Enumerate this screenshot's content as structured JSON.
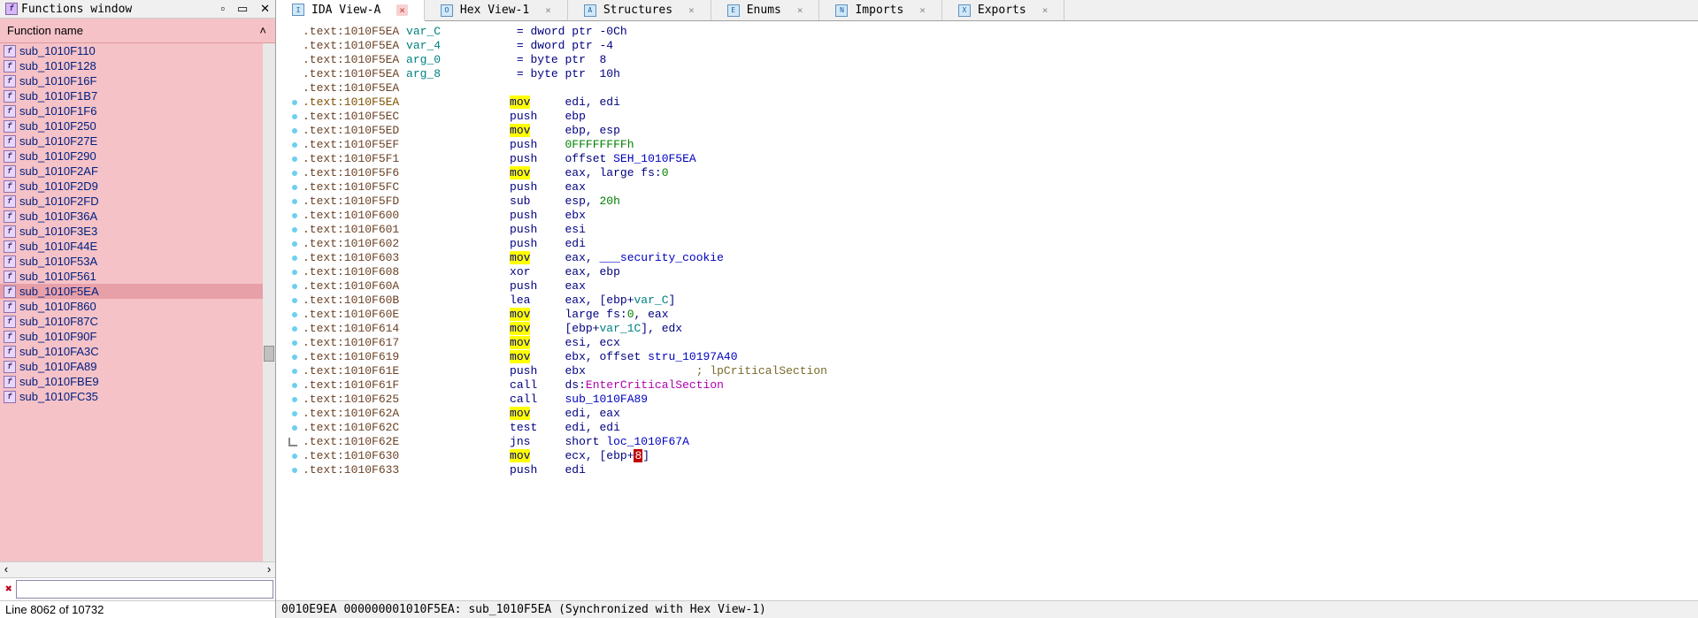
{
  "left": {
    "title": "Functions window",
    "column": "Function name",
    "functions": [
      {
        "name": "sub_1010F110",
        "selected": false
      },
      {
        "name": "sub_1010F128",
        "selected": false
      },
      {
        "name": "sub_1010F16F",
        "selected": false
      },
      {
        "name": "sub_1010F1B7",
        "selected": false
      },
      {
        "name": "sub_1010F1F6",
        "selected": false
      },
      {
        "name": "sub_1010F250",
        "selected": false
      },
      {
        "name": "sub_1010F27E",
        "selected": false
      },
      {
        "name": "sub_1010F290",
        "selected": false
      },
      {
        "name": "sub_1010F2AF",
        "selected": false
      },
      {
        "name": "sub_1010F2D9",
        "selected": false
      },
      {
        "name": "sub_1010F2FD",
        "selected": false
      },
      {
        "name": "sub_1010F36A",
        "selected": false
      },
      {
        "name": "sub_1010F3E3",
        "selected": false
      },
      {
        "name": "sub_1010F44E",
        "selected": false
      },
      {
        "name": "sub_1010F53A",
        "selected": false
      },
      {
        "name": "sub_1010F561",
        "selected": false
      },
      {
        "name": "sub_1010F5EA",
        "selected": true
      },
      {
        "name": "sub_1010F860",
        "selected": false
      },
      {
        "name": "sub_1010F87C",
        "selected": false
      },
      {
        "name": "sub_1010F90F",
        "selected": false
      },
      {
        "name": "sub_1010FA3C",
        "selected": false
      },
      {
        "name": "sub_1010FA89",
        "selected": false
      },
      {
        "name": "sub_1010FBE9",
        "selected": false
      },
      {
        "name": "sub_1010FC35",
        "selected": false
      }
    ],
    "status": "Line 8062 of 10732"
  },
  "tabs": [
    {
      "label": "IDA View-A",
      "active": true,
      "icon": "I"
    },
    {
      "label": "Hex View-1",
      "active": false,
      "icon": "O"
    },
    {
      "label": "Structures",
      "active": false,
      "icon": "A"
    },
    {
      "label": "Enums",
      "active": false,
      "icon": "E"
    },
    {
      "label": "Imports",
      "active": false,
      "icon": "N"
    },
    {
      "label": "Exports",
      "active": false,
      "icon": "X"
    }
  ],
  "disasm": [
    {
      "dot": false,
      "addr": ".text:1010F5EA",
      "var": "var_C",
      "eq": "= dword ptr -0Ch"
    },
    {
      "dot": false,
      "addr": ".text:1010F5EA",
      "var": "var_4",
      "eq": "= dword ptr -4"
    },
    {
      "dot": false,
      "addr": ".text:1010F5EA",
      "var": "arg_0",
      "eq": "= byte ptr  8"
    },
    {
      "dot": false,
      "addr": ".text:1010F5EA",
      "var": "arg_8",
      "eq": "= byte ptr  10h"
    },
    {
      "dot": false,
      "addr": ".text:1010F5EA"
    },
    {
      "dot": true,
      "addr": ".text:1010F5EA",
      "addrcls": "addr-b",
      "mn": "mov",
      "hl": true,
      "ops": [
        {
          "t": "edi, edi",
          "c": "op-reg"
        }
      ]
    },
    {
      "dot": true,
      "addr": ".text:1010F5EC",
      "mn": "push",
      "ops": [
        {
          "t": "ebp",
          "c": "op-reg"
        }
      ]
    },
    {
      "dot": true,
      "addr": ".text:1010F5ED",
      "mn": "mov",
      "hl": true,
      "ops": [
        {
          "t": "ebp, esp",
          "c": "op-reg"
        }
      ]
    },
    {
      "dot": true,
      "addr": ".text:1010F5EF",
      "mn": "push",
      "ops": [
        {
          "t": "0FFFFFFFFh",
          "c": "op-const"
        }
      ]
    },
    {
      "dot": true,
      "addr": ".text:1010F5F1",
      "mn": "push",
      "ops": [
        {
          "t": "offset ",
          "c": "op-reg"
        },
        {
          "t": "SEH_1010F5EA",
          "c": "op-ref"
        }
      ]
    },
    {
      "dot": true,
      "addr": ".text:1010F5F6",
      "mn": "mov",
      "hl": true,
      "ops": [
        {
          "t": "eax, ",
          "c": "op-reg"
        },
        {
          "t": "large fs:",
          "c": "op-reg"
        },
        {
          "t": "0",
          "c": "op-const"
        }
      ]
    },
    {
      "dot": true,
      "addr": ".text:1010F5FC",
      "mn": "push",
      "ops": [
        {
          "t": "eax",
          "c": "op-reg"
        }
      ]
    },
    {
      "dot": true,
      "addr": ".text:1010F5FD",
      "mn": "sub",
      "ops": [
        {
          "t": "esp, ",
          "c": "op-reg"
        },
        {
          "t": "20h",
          "c": "op-const"
        }
      ]
    },
    {
      "dot": true,
      "addr": ".text:1010F600",
      "mn": "push",
      "ops": [
        {
          "t": "ebx",
          "c": "op-reg"
        }
      ]
    },
    {
      "dot": true,
      "addr": ".text:1010F601",
      "mn": "push",
      "ops": [
        {
          "t": "esi",
          "c": "op-reg"
        }
      ]
    },
    {
      "dot": true,
      "addr": ".text:1010F602",
      "mn": "push",
      "ops": [
        {
          "t": "edi",
          "c": "op-reg"
        }
      ]
    },
    {
      "dot": true,
      "addr": ".text:1010F603",
      "mn": "mov",
      "hl": true,
      "ops": [
        {
          "t": "eax, ",
          "c": "op-reg"
        },
        {
          "t": "___security_cookie",
          "c": "op-ref"
        }
      ]
    },
    {
      "dot": true,
      "addr": ".text:1010F608",
      "mn": "xor",
      "ops": [
        {
          "t": "eax, ebp",
          "c": "op-reg"
        }
      ]
    },
    {
      "dot": true,
      "addr": ".text:1010F60A",
      "mn": "push",
      "ops": [
        {
          "t": "eax",
          "c": "op-reg"
        }
      ]
    },
    {
      "dot": true,
      "addr": ".text:1010F60B",
      "mn": "lea",
      "ops": [
        {
          "t": "eax, [ebp+",
          "c": "op-reg"
        },
        {
          "t": "var_C",
          "c": "op-var"
        },
        {
          "t": "]",
          "c": "op-reg"
        }
      ]
    },
    {
      "dot": true,
      "addr": ".text:1010F60E",
      "mn": "mov",
      "hl": true,
      "ops": [
        {
          "t": "large fs:",
          "c": "op-reg"
        },
        {
          "t": "0",
          "c": "op-const"
        },
        {
          "t": ", eax",
          "c": "op-reg"
        }
      ]
    },
    {
      "dot": true,
      "addr": ".text:1010F614",
      "mn": "mov",
      "hl": true,
      "ops": [
        {
          "t": "[ebp+",
          "c": "op-reg"
        },
        {
          "t": "var_1C",
          "c": "op-var"
        },
        {
          "t": "], edx",
          "c": "op-reg"
        }
      ]
    },
    {
      "dot": true,
      "addr": ".text:1010F617",
      "mn": "mov",
      "hl": true,
      "ops": [
        {
          "t": "esi, ecx",
          "c": "op-reg"
        }
      ]
    },
    {
      "dot": true,
      "addr": ".text:1010F619",
      "mn": "mov",
      "hl": true,
      "ops": [
        {
          "t": "ebx, ",
          "c": "op-reg"
        },
        {
          "t": "offset ",
          "c": "op-reg"
        },
        {
          "t": "stru_10197A40",
          "c": "op-ref"
        }
      ]
    },
    {
      "dot": true,
      "addr": ".text:1010F61E",
      "mn": "push",
      "ops": [
        {
          "t": "ebx",
          "c": "op-reg"
        }
      ],
      "comment": "; lpCriticalSection"
    },
    {
      "dot": true,
      "addr": ".text:1010F61F",
      "mn": "call",
      "ops": [
        {
          "t": "ds:",
          "c": "op-reg"
        },
        {
          "t": "EnterCriticalSection",
          "c": "op-call"
        }
      ]
    },
    {
      "dot": true,
      "addr": ".text:1010F625",
      "mn": "call",
      "ops": [
        {
          "t": "sub_1010FA89",
          "c": "op-ref"
        }
      ]
    },
    {
      "dot": true,
      "addr": ".text:1010F62A",
      "mn": "mov",
      "hl": true,
      "ops": [
        {
          "t": "edi, eax",
          "c": "op-reg"
        }
      ]
    },
    {
      "dot": true,
      "addr": ".text:1010F62C",
      "mn": "test",
      "ops": [
        {
          "t": "edi, edi",
          "c": "op-reg"
        }
      ]
    },
    {
      "dot": true,
      "arrow": true,
      "addr": ".text:1010F62E",
      "mn": "jns",
      "ops": [
        {
          "t": "short ",
          "c": "op-reg"
        },
        {
          "t": "loc_1010F67A",
          "c": "op-ref"
        }
      ]
    },
    {
      "dot": true,
      "addr": ".text:1010F630",
      "mn": "mov",
      "hl": true,
      "ops": [
        {
          "t": "ecx, [ebp+",
          "c": "op-reg"
        },
        {
          "t": "8",
          "c": "red-cursor"
        },
        {
          "t": "]",
          "c": "op-reg"
        }
      ]
    },
    {
      "dot": true,
      "addr": ".text:1010F633",
      "mn": "push",
      "ops": [
        {
          "t": "edi",
          "c": "op-reg"
        }
      ]
    }
  ],
  "sync": "0010E9EA 000000001010F5EA: sub_1010F5EA (Synchronized with Hex View-1)"
}
